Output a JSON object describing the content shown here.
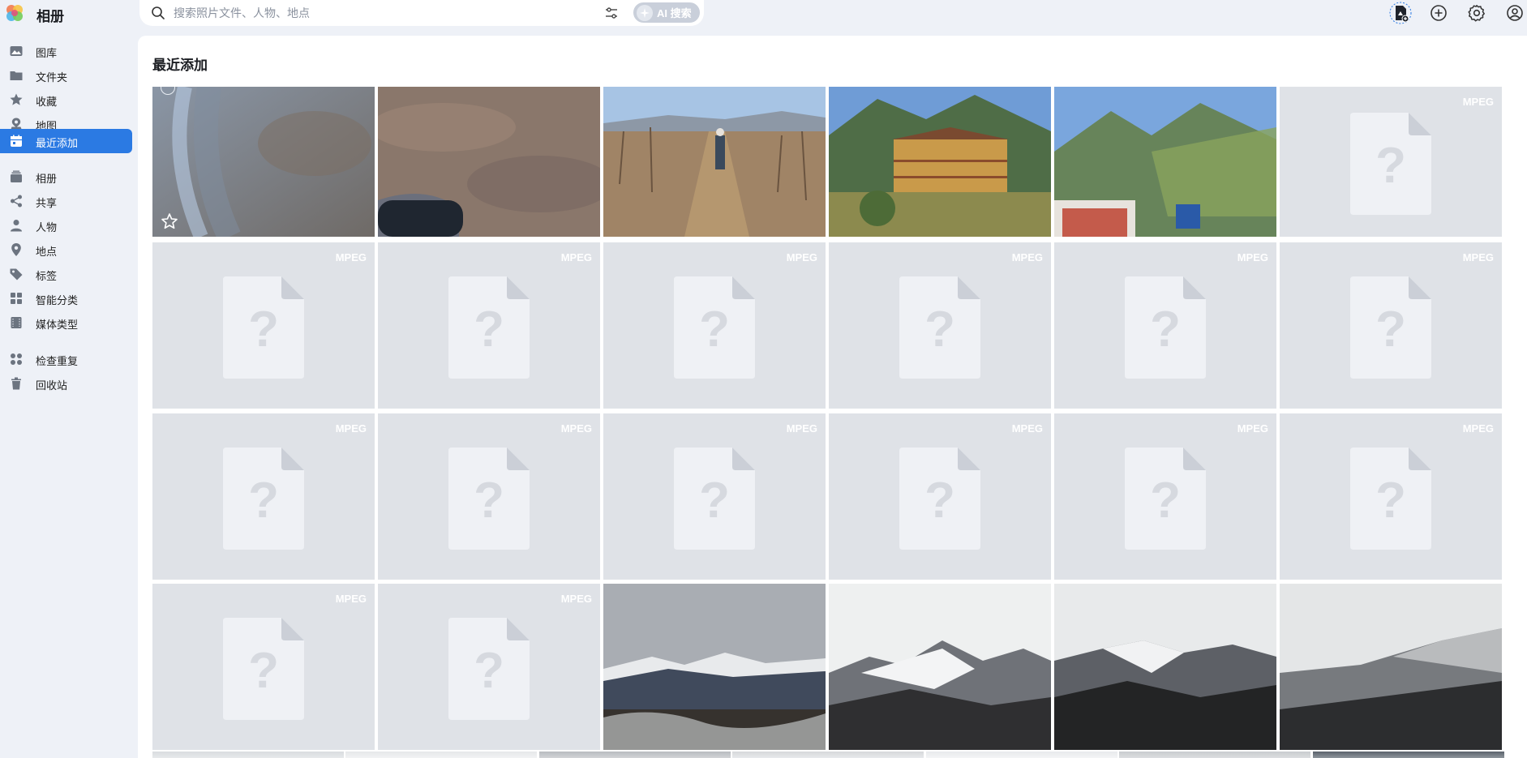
{
  "app": {
    "title": "相册"
  },
  "search": {
    "placeholder": "搜索照片文件、人物、地点",
    "ai_label": "AI 搜索"
  },
  "header_icons": [
    "upload-icon",
    "add-icon",
    "settings-icon",
    "account-icon"
  ],
  "sidebar": {
    "group1": [
      {
        "label": "图库",
        "icon": "gallery-icon"
      },
      {
        "label": "文件夹",
        "icon": "folder-icon"
      },
      {
        "label": "收藏",
        "icon": "star-icon"
      },
      {
        "label": "地图",
        "icon": "map-icon"
      },
      {
        "label": "最近添加",
        "icon": "calendar-icon",
        "active": true
      }
    ],
    "group2": [
      {
        "label": "相册",
        "icon": "album-icon"
      },
      {
        "label": "共享",
        "icon": "share-icon"
      },
      {
        "label": "人物",
        "icon": "person-icon"
      },
      {
        "label": "地点",
        "icon": "location-icon"
      },
      {
        "label": "标签",
        "icon": "tag-icon"
      },
      {
        "label": "智能分类",
        "icon": "smart-category-icon"
      },
      {
        "label": "媒体类型",
        "icon": "media-type-icon"
      }
    ],
    "group3": [
      {
        "label": "检查重复",
        "icon": "duplicate-icon"
      },
      {
        "label": "回收站",
        "icon": "trash-icon"
      }
    ]
  },
  "main": {
    "title": "最近添加"
  },
  "placeholder_label": "MPEG",
  "colors": {
    "accent": "#2b7ae3",
    "placeholder_bg": "#dfe2e7",
    "sidebar_bg": "#eef1f7"
  }
}
